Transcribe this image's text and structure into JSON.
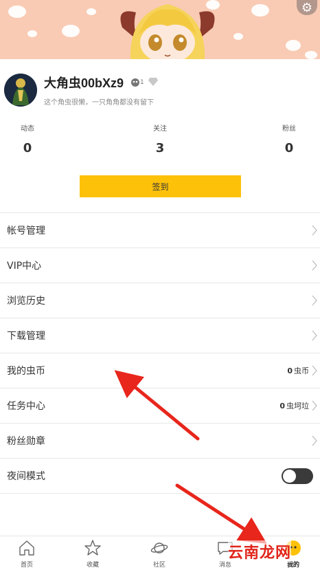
{
  "profile": {
    "username": "大角虫00bXz9",
    "level_badge": "1",
    "bio": "这个角虫很懒，一只角角都没有留下"
  },
  "stats": [
    {
      "label": "动态",
      "value": "0"
    },
    {
      "label": "关注",
      "value": "3"
    },
    {
      "label": "粉丝",
      "value": "0"
    }
  ],
  "signin_label": "签到",
  "menu": [
    {
      "label": "帐号管理"
    },
    {
      "label": "VIP中心"
    },
    {
      "label": "浏览历史"
    },
    {
      "label": "下载管理"
    },
    {
      "label": "我的虫币",
      "value": "0",
      "unit": "虫币"
    },
    {
      "label": "任务中心",
      "value": "0",
      "unit": "虫坷垃"
    },
    {
      "label": "粉丝勋章"
    },
    {
      "label": "夜间模式",
      "toggle": false
    }
  ],
  "tabs": [
    {
      "label": "首页",
      "icon": "home-icon"
    },
    {
      "label": "收藏",
      "icon": "star-icon"
    },
    {
      "label": "社区",
      "icon": "planet-icon"
    },
    {
      "label": "消息",
      "icon": "message-icon"
    },
    {
      "label": "我的",
      "icon": "profile-icon",
      "active": true
    }
  ],
  "watermark": "云南龙网",
  "colors": {
    "accent": "#fec10a",
    "banner": "#f9cbb4",
    "arrow": "#e8261c"
  }
}
